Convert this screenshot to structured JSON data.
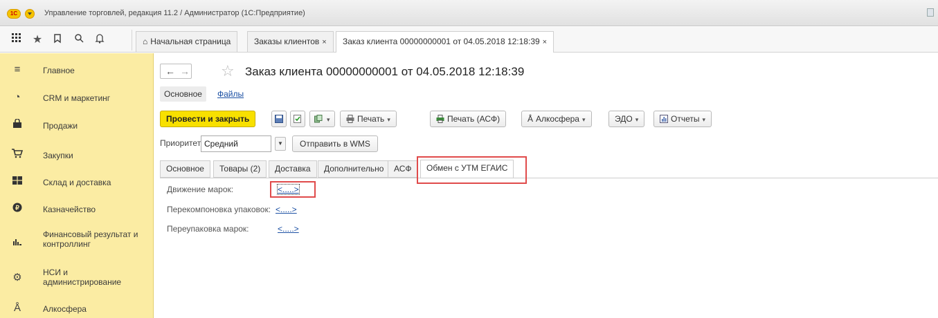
{
  "window": {
    "title": "Управление торговлей, редакция 11.2 / Администратор  (1С:Предприятие)",
    "logo_text": "1С"
  },
  "topbar": {
    "icons": [
      "apps-grid-icon",
      "star-icon",
      "history-icon",
      "search-icon",
      "bell-icon"
    ],
    "tabs": [
      {
        "label": "Начальная страница",
        "closable": false,
        "icon": "home-icon"
      },
      {
        "label": "Заказы клиентов",
        "closable": true,
        "close": "×"
      },
      {
        "label": "Заказ клиента 00000000001 от 04.05.2018 12:18:39",
        "closable": true,
        "close": "×"
      }
    ]
  },
  "sidebar": {
    "items": [
      {
        "label": "Главное",
        "icon": "menu-lines-icon"
      },
      {
        "label": "CRM и маркетинг",
        "icon": "pie-chart-icon"
      },
      {
        "label": "Продажи",
        "icon": "bag-icon"
      },
      {
        "label": "Закупки",
        "icon": "cart-icon"
      },
      {
        "label": "Склад и доставка",
        "icon": "warehouse-icon"
      },
      {
        "label": "Казначейство",
        "icon": "coin-icon"
      },
      {
        "label": "Финансовый результат и контроллинг",
        "icon": "bar-chart-icon"
      },
      {
        "label": "НСИ и администрирование",
        "icon": "gear-icon"
      },
      {
        "label": "Алкосфера",
        "icon": "alko-icon"
      }
    ]
  },
  "document": {
    "title": "Заказ клиента 00000000001 от 04.05.2018 12:18:39",
    "subnav": {
      "main": "Основное",
      "files": "Файлы"
    },
    "commands": {
      "post_close": "Провести и закрыть",
      "print": "Печать",
      "print_asf": "Печать (АСФ)",
      "alkosfera": "Алкосфера",
      "edo": "ЭДО",
      "reports": "Отчеты"
    },
    "priority": {
      "label": "Приоритет:",
      "value": "Средний"
    },
    "wms_button": "Отправить в WMS",
    "form_tabs": [
      "Основное",
      "Товары (2)",
      "Доставка",
      "Дополнительно",
      "АСФ",
      "Обмен с УТМ ЕГАИС"
    ],
    "active_tab": "Обмен с УТМ ЕГАИС",
    "rows": [
      {
        "label": "Движение марок:",
        "link": "<.....>"
      },
      {
        "label": "Перекомпоновка упаковок:",
        "link": "<.....>"
      },
      {
        "label": "Переупаковка марок:",
        "link": "<.....>"
      }
    ]
  },
  "colors": {
    "sidebar_bg": "#fbeca3",
    "primary_button": "#f8e000",
    "link": "#1a4fa3",
    "highlight_box": "#e04a4a"
  }
}
